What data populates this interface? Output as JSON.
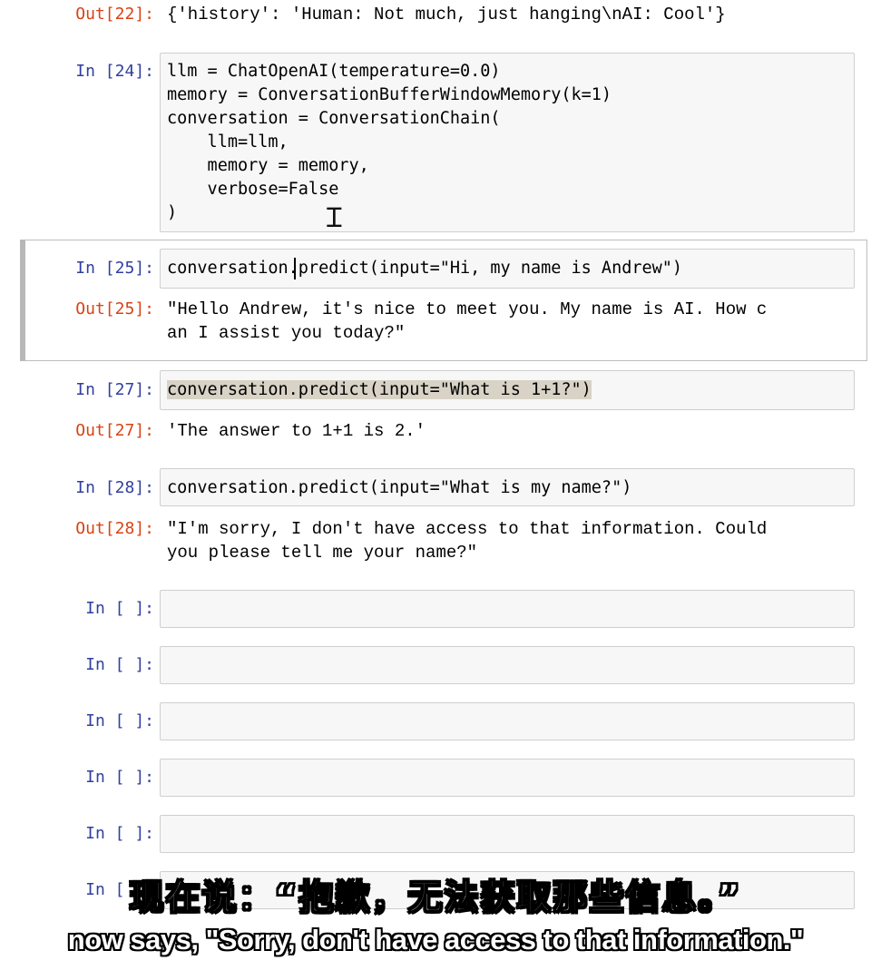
{
  "cells": {
    "out22": {
      "prompt": "Out[22]:",
      "text": "{'history': 'Human: Not much, just hanging\\nAI: Cool'}"
    },
    "in24": {
      "prompt": "In [24]:",
      "lines": [
        "llm = ChatOpenAI(temperature=0.0)",
        "memory = ConversationBufferWindowMemory(k=1)",
        "conversation = ConversationChain(",
        "    llm=llm,",
        "    memory = memory,",
        "    verbose=False",
        ")"
      ]
    },
    "in25": {
      "prompt": "In [25]:",
      "code": "conversation.predict(input=\"Hi, my name is Andrew\")"
    },
    "out25": {
      "prompt": "Out[25]:",
      "lines": [
        "\"Hello Andrew, it's nice to meet you. My name is AI. How c",
        "an I assist you today?\""
      ]
    },
    "in27": {
      "prompt": "In [27]:",
      "code": "conversation.predict(input=\"What is 1+1?\")"
    },
    "out27": {
      "prompt": "Out[27]:",
      "text": "'The answer to 1+1 is 2.'"
    },
    "in28": {
      "prompt": "In [28]:",
      "code": "conversation.predict(input=\"What is my name?\")"
    },
    "out28": {
      "prompt": "Out[28]:",
      "lines": [
        "\"I'm sorry, I don't have access to that information. Could",
        "you please tell me your name?\""
      ]
    },
    "empty_prompt": "In [ ]:"
  },
  "subtitles": {
    "zh": "现在说：“抱歉，无法获取那些信息。”",
    "en": "now says, \"Sorry, don't have access to that information.\""
  },
  "colors": {
    "in_prompt": "#303f9f",
    "out_prompt": "#d84315",
    "selected_border": "#42a5f5",
    "input_bg": "#f7f7f7"
  }
}
